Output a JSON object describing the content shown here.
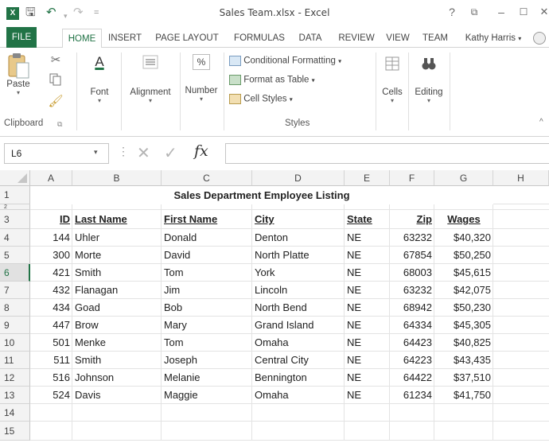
{
  "window": {
    "title": "Sales Team.xlsx - Excel",
    "help": "?",
    "restore": "⧉",
    "minimize": "–",
    "maximize": "☐",
    "close": "✕"
  },
  "qat": {
    "undo": "↶",
    "redo": "↷",
    "dropdown": "="
  },
  "tabs": [
    "FILE",
    "HOME",
    "INSERT",
    "PAGE LAYOUT",
    "FORMULAS",
    "DATA",
    "REVIEW",
    "VIEW",
    "TEAM"
  ],
  "user": "Kathy Harris",
  "ribbon": {
    "paste": "Paste",
    "clipboard": "Clipboard",
    "font": "Font",
    "alignment": "Alignment",
    "number": "Number",
    "conditional": "Conditional Formatting",
    "format_table": "Format as Table",
    "cell_styles": "Cell Styles",
    "styles": "Styles",
    "cells": "Cells",
    "editing": "Editing",
    "number_glyph": "%",
    "font_glyph": "A"
  },
  "formula": {
    "namebox": "L6",
    "fx": "fx",
    "value": ""
  },
  "columns": [
    "A",
    "B",
    "C",
    "D",
    "E",
    "F",
    "G",
    "H"
  ],
  "rows": [
    "1",
    "2",
    "3",
    "4",
    "5",
    "6",
    "7",
    "8",
    "9",
    "10",
    "11",
    "12",
    "13",
    "14",
    "15"
  ],
  "selected_row": "6",
  "sheet_title": "Sales Department Employee Listing",
  "headers": {
    "id": "ID",
    "last": "Last Name",
    "first": "First Name",
    "city": "City",
    "state": "State",
    "zip": "Zip",
    "wages": "Wages"
  },
  "employees": [
    {
      "id": "144",
      "last": "Uhler",
      "first": "Donald",
      "city": "Denton",
      "state": "NE",
      "zip": "63232",
      "wages": "$40,320"
    },
    {
      "id": "300",
      "last": "Morte",
      "first": "David",
      "city": "North Platte",
      "state": "NE",
      "zip": "67854",
      "wages": "$50,250"
    },
    {
      "id": "421",
      "last": "Smith",
      "first": "Tom",
      "city": "York",
      "state": "NE",
      "zip": "68003",
      "wages": "$45,615"
    },
    {
      "id": "432",
      "last": "Flanagan",
      "first": "Jim",
      "city": "Lincoln",
      "state": "NE",
      "zip": "63232",
      "wages": "$42,075"
    },
    {
      "id": "434",
      "last": "Goad",
      "first": "Bob",
      "city": "North Bend",
      "state": "NE",
      "zip": "68942",
      "wages": "$50,230"
    },
    {
      "id": "447",
      "last": "Brow",
      "first": "Mary",
      "city": "Grand Island",
      "state": "NE",
      "zip": "64334",
      "wages": "$45,305"
    },
    {
      "id": "501",
      "last": "Menke",
      "first": "Tom",
      "city": "Omaha",
      "state": "NE",
      "zip": "64423",
      "wages": "$40,825"
    },
    {
      "id": "511",
      "last": "Smith",
      "first": "Joseph",
      "city": "Central City",
      "state": "NE",
      "zip": "64223",
      "wages": "$43,435"
    },
    {
      "id": "516",
      "last": "Johnson",
      "first": "Melanie",
      "city": "Bennington",
      "state": "NE",
      "zip": "64422",
      "wages": "$37,510"
    },
    {
      "id": "524",
      "last": "Davis",
      "first": "Maggie",
      "city": "Omaha",
      "state": "NE",
      "zip": "61234",
      "wages": "$41,750"
    }
  ],
  "colors": {
    "accent": "#217346",
    "header_bg": "#f3f3f3",
    "grid": "#e3e3e3"
  }
}
